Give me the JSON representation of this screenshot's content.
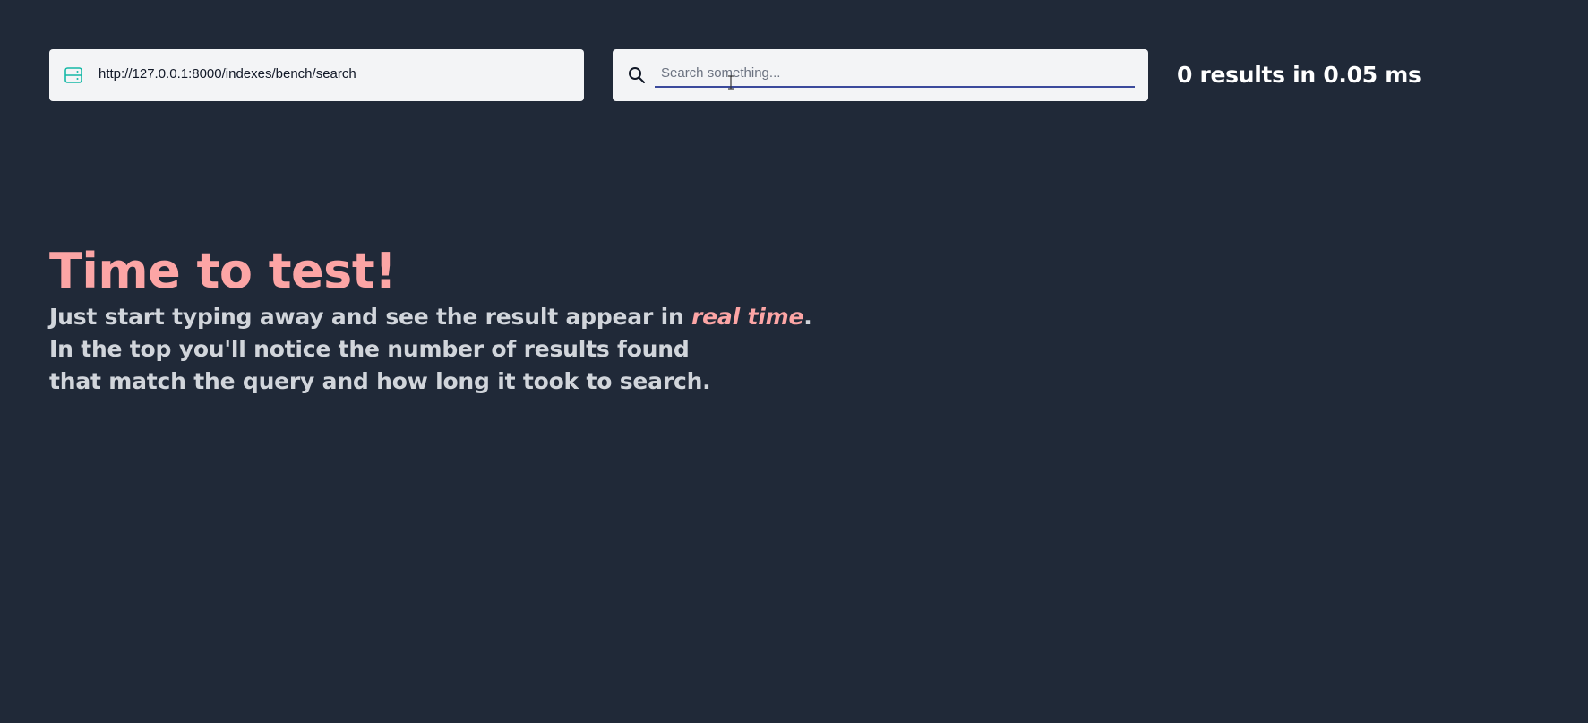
{
  "url_field": {
    "icon": "server-icon",
    "value": "http://127.0.0.1:8000/indexes/bench/search"
  },
  "search": {
    "icon": "search-icon",
    "placeholder": "Search something...",
    "value": ""
  },
  "status": {
    "results_text": "0 results in 0.05 ms"
  },
  "hero": {
    "title": "Time to test!",
    "line1_prefix": "Just start typing away and see the result appear in ",
    "line1_emphasis": "real time",
    "line1_suffix": ".",
    "line2": "In the top you'll notice the number of results found",
    "line3": "that match the query and how long it took to search."
  },
  "colors": {
    "background": "#202938",
    "accent": "#fca5a5",
    "text": "#d1d5db",
    "input_bg": "#f3f4f6",
    "input_underline": "#3b4a9c",
    "server_icon": "#14b8a6"
  }
}
